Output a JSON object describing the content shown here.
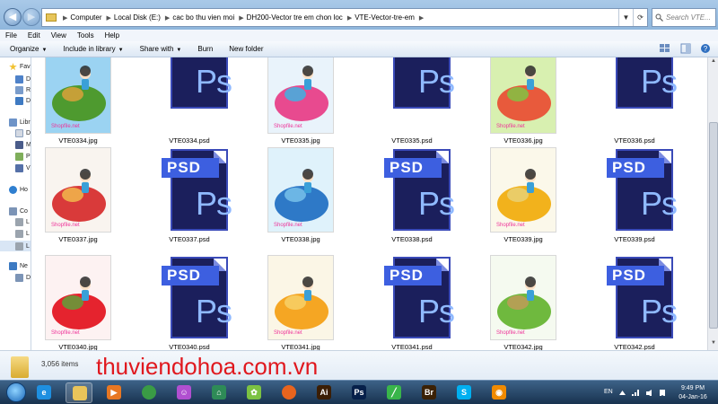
{
  "address_bar": {
    "crumbs": [
      "Computer",
      "Local Disk (E:)",
      "cac bo thu vien moi",
      "DH200-Vector tre em chon loc",
      "VTE-Vector-tre-em"
    ],
    "search_placeholder": "Search VTE..."
  },
  "menu": [
    "File",
    "Edit",
    "View",
    "Tools",
    "Help"
  ],
  "toolbar": {
    "organize": "Organize",
    "include_in_library": "Include in library",
    "share_with": "Share with",
    "burn": "Burn",
    "new_folder": "New folder"
  },
  "nav_pane": [
    "Fav",
    "D",
    "R",
    "D",
    "Libr",
    "D",
    "M",
    "P",
    "V",
    "Ho",
    "Co",
    "L",
    "L",
    "L",
    "Ne",
    "D"
  ],
  "files": [
    {
      "name": "VTE0334.jpg",
      "kind": "jpg",
      "art": "turtle"
    },
    {
      "name": "VTE0334.psd",
      "kind": "psd"
    },
    {
      "name": "VTE0335.jpg",
      "kind": "jpg",
      "art": "pinwheel"
    },
    {
      "name": "VTE0335.psd",
      "kind": "psd"
    },
    {
      "name": "VTE0336.jpg",
      "kind": "jpg",
      "art": "mushrooms"
    },
    {
      "name": "VTE0336.psd",
      "kind": "psd"
    },
    {
      "name": "VTE0337.jpg",
      "kind": "jpg",
      "art": "birdhouse"
    },
    {
      "name": "VTE0337.psd",
      "kind": "psd"
    },
    {
      "name": "VTE0338.jpg",
      "kind": "jpg",
      "art": "whale"
    },
    {
      "name": "VTE0338.psd",
      "kind": "psd"
    },
    {
      "name": "VTE0339.jpg",
      "kind": "jpg",
      "art": "lemon"
    },
    {
      "name": "VTE0339.psd",
      "kind": "psd"
    },
    {
      "name": "VTE0340.jpg",
      "kind": "jpg",
      "art": "strawberry"
    },
    {
      "name": "VTE0340.psd",
      "kind": "psd"
    },
    {
      "name": "VTE0341.jpg",
      "kind": "jpg",
      "art": "moon"
    },
    {
      "name": "VTE0341.psd",
      "kind": "psd"
    },
    {
      "name": "VTE0342.jpg",
      "kind": "jpg",
      "art": "snail"
    },
    {
      "name": "VTE0342.psd",
      "kind": "psd"
    }
  ],
  "psd_icon": {
    "banner": "PSD",
    "glyph": "Ps"
  },
  "jpg_watermark": "Shopfile.net",
  "details": {
    "item_count": "3,056 items"
  },
  "overlay_watermark": "thuviendohoa.com.vn",
  "taskbar": {
    "apps": [
      {
        "name": "ie",
        "glyph": "e",
        "color": "#1e8fe0"
      },
      {
        "name": "explorer",
        "glyph": "",
        "color": "#e9c45a"
      },
      {
        "name": "media",
        "glyph": "▶",
        "color": "#e87722"
      },
      {
        "name": "chrome",
        "glyph": "",
        "color": "#3a9b45"
      },
      {
        "name": "app5",
        "glyph": "☺",
        "color": "#b04fd0"
      },
      {
        "name": "app6",
        "glyph": "⌂",
        "color": "#2e8b57"
      },
      {
        "name": "app7",
        "glyph": "✿",
        "color": "#7cc242"
      },
      {
        "name": "firefox",
        "glyph": "",
        "color": "#e8641e"
      },
      {
        "name": "illustrator",
        "glyph": "Ai",
        "color": "#3b1e05"
      },
      {
        "name": "photoshop",
        "glyph": "Ps",
        "color": "#06204a"
      },
      {
        "name": "app11",
        "glyph": "╱",
        "color": "#39b54a"
      },
      {
        "name": "bridge",
        "glyph": "Br",
        "color": "#3b2105"
      },
      {
        "name": "skype",
        "glyph": "S",
        "color": "#00aff0"
      },
      {
        "name": "app14",
        "glyph": "◉",
        "color": "#f08a00"
      }
    ],
    "language": "EN",
    "time": "9:49 PM",
    "date": "04-Jan-16"
  },
  "colors": {
    "psd_dark": "#1b1f5c",
    "psd_banner": "#3d5fe0",
    "watermark_red": "#e0181e",
    "taskbar": "#24476b"
  }
}
